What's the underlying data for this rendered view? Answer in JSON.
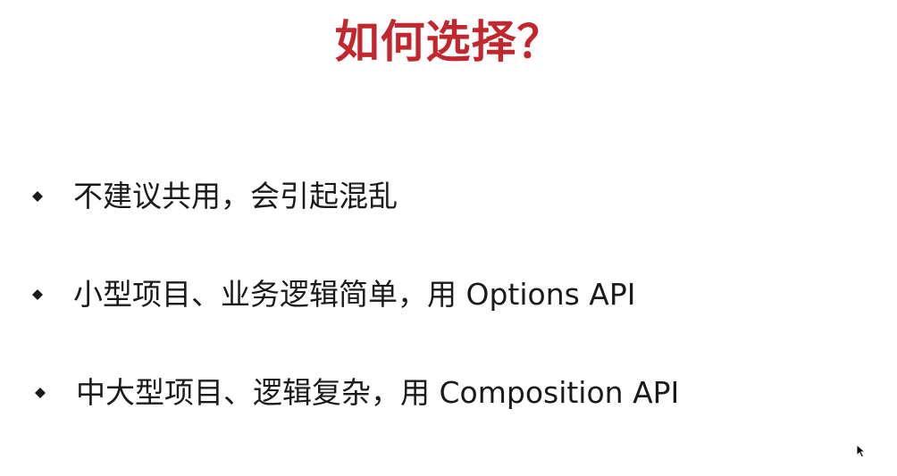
{
  "slide": {
    "title": "如何选择？",
    "bullets": [
      {
        "text": "不建议共用，会引起混乱",
        "icon": "diamond-bullet-icon"
      },
      {
        "text": "小型项目、业务逻辑简单，用 Options API",
        "icon": "diamond-bullet-icon"
      },
      {
        "text": "中大型项目、逻辑复杂，用 Composition API",
        "icon": "diamond-bullet-icon"
      }
    ]
  },
  "colors": {
    "title": "#c1272d",
    "text": "#1a1a1a",
    "bullet": "#1a1a1a",
    "background": "#ffffff"
  },
  "icons": {
    "cursor": "mouse-pointer-icon"
  }
}
